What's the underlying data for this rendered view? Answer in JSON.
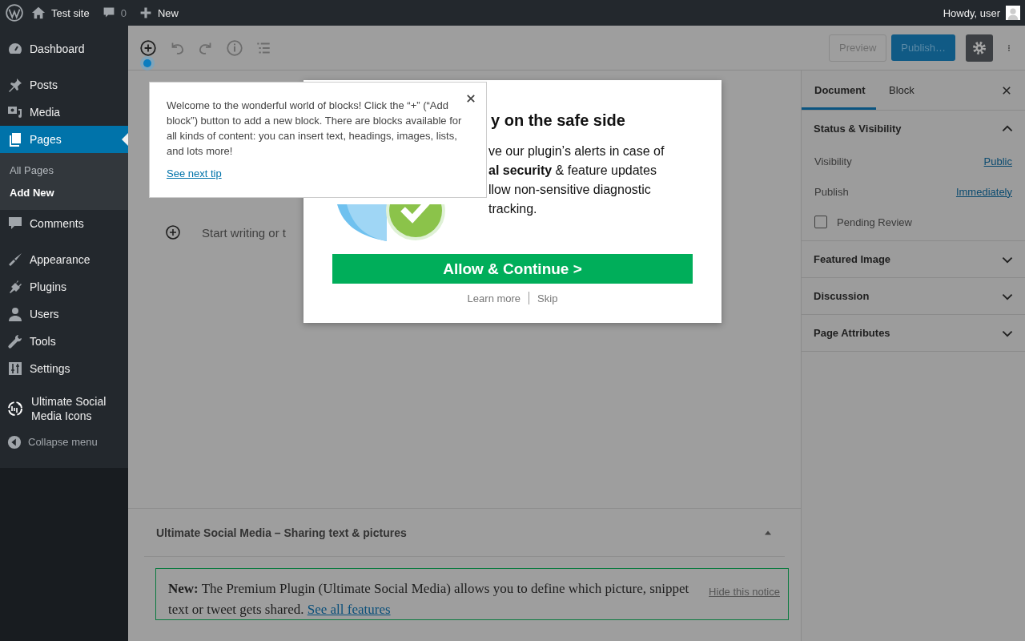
{
  "admin_bar": {
    "site": "Test site",
    "comments": "0",
    "new": "New",
    "greeting": "Howdy, user"
  },
  "admin_menu": {
    "items": [
      {
        "label": "Dashboard",
        "selected": false
      },
      {
        "label": "Posts",
        "selected": false
      },
      {
        "label": "Media",
        "selected": false
      },
      {
        "label": "Pages",
        "selected": true,
        "children": [
          {
            "label": "All Pages",
            "selected": false
          },
          {
            "label": "Add New",
            "selected": true
          }
        ]
      },
      {
        "label": "Comments",
        "selected": false
      },
      {
        "label": "Appearance",
        "selected": false
      },
      {
        "label": "Plugins",
        "selected": false
      },
      {
        "label": "Users",
        "selected": false
      },
      {
        "label": "Tools",
        "selected": false
      },
      {
        "label": "Settings",
        "selected": false
      },
      {
        "label": "Ultimate Social Media Icons",
        "selected": false
      }
    ],
    "collapse": "Collapse menu"
  },
  "editor": {
    "buttons": [
      "Preview",
      "Publish…"
    ],
    "placeholder": "Start writing or t"
  },
  "settings_sidebar": {
    "tabs": [
      {
        "label": "Document",
        "selected": true
      },
      {
        "label": "Block",
        "selected": false
      }
    ],
    "panels": [
      {
        "title": "Status & Visibility",
        "expanded": true,
        "rows": [
          {
            "kind": "link",
            "label": "Visibility",
            "value": "Public"
          },
          {
            "kind": "link",
            "label": "Publish",
            "value": "Immediately"
          },
          {
            "kind": "checkbox",
            "label": "Pending Review",
            "checked": false
          }
        ]
      },
      {
        "title": "Featured Image",
        "expanded": false
      },
      {
        "title": "Discussion",
        "expanded": false
      },
      {
        "title": "Page Attributes",
        "expanded": false
      }
    ]
  },
  "meta_box": {
    "title": "Ultimate Social Media – Sharing text & pictures",
    "expanded": true,
    "notice": {
      "text": "**New:** The Premium Plugin (Ultimate Social Media) allows you to define which picture, snippet text or tweet gets shared.",
      "link": "See all features",
      "dismiss": "Hide this notice"
    }
  },
  "tip": {
    "text": "Welcome to the wonderful world of blocks! Click the “+” (“Add block”) button to add a new block. There are blocks available for all kinds of content: you can insert text, headings, images, lists, and lots more!",
    "link": "See next tip"
  },
  "opt_in_modal": {
    "title": "y on the safe side",
    "lines": [
      "ve our plugin’s alerts in case of",
      "**al security** & feature updates",
      "llow non-sensitive diagnostic",
      "tracking."
    ],
    "button": "Allow & Continue >",
    "links": [
      "Learn more",
      "Skip"
    ]
  }
}
